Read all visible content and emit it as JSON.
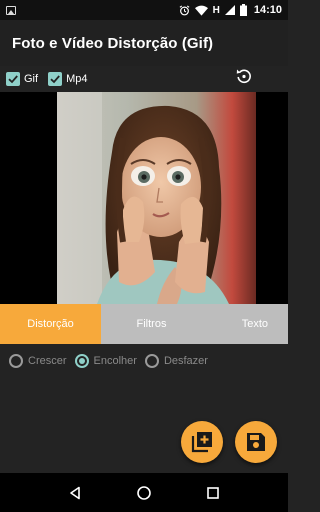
{
  "status_bar": {
    "time": "14:10",
    "network": "H",
    "icons": [
      "image-notification-icon",
      "alarm-icon",
      "wifi-icon",
      "cell-signal-icon",
      "battery-icon"
    ]
  },
  "app_bar": {
    "title": "Foto e Vídeo Distorção (Gif)"
  },
  "options": {
    "gif_label": "Gif",
    "gif_checked": true,
    "mp4_label": "Mp4",
    "mp4_checked": true,
    "reset_icon": "rotate-reset-icon"
  },
  "tabs": [
    {
      "label": "Distorção",
      "active": true
    },
    {
      "label": "Filtros",
      "active": false
    },
    {
      "label": "Texto",
      "active": false
    }
  ],
  "modes": [
    {
      "label": "Crescer",
      "selected": false
    },
    {
      "label": "Encolher",
      "selected": true
    },
    {
      "label": "Desfazer",
      "selected": false
    }
  ],
  "fabs": {
    "add_icon": "add-to-library-icon",
    "save_icon": "save-floppy-icon"
  },
  "nav": {
    "back_icon": "back-triangle-icon",
    "home_icon": "home-circle-icon",
    "recents_icon": "recents-square-icon"
  },
  "colors": {
    "accent": "#f7a93b",
    "check": "#8fd0c9",
    "background": "#232323"
  }
}
